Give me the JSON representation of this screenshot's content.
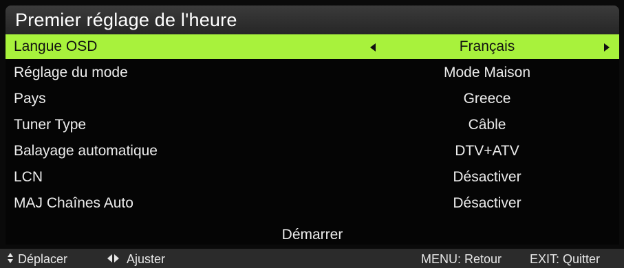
{
  "title": "Premier réglage de l'heure",
  "colors": {
    "highlight": "#a8f23c",
    "background": "#0a0a0a",
    "title_bar": "#333333",
    "footer": "#2b2b2b"
  },
  "menu": {
    "rows": [
      {
        "label": "Langue OSD",
        "value": "Français",
        "selected": true
      },
      {
        "label": "Réglage du mode",
        "value": "Mode Maison"
      },
      {
        "label": "Pays",
        "value": "Greece"
      },
      {
        "label": "Tuner Type",
        "value": "Câble"
      },
      {
        "label": "Balayage automatique",
        "value": "DTV+ATV"
      },
      {
        "label": "LCN",
        "value": "Désactiver"
      },
      {
        "label": "MAJ Chaînes Auto",
        "value": "Désactiver"
      }
    ],
    "start_label": "Démarrer"
  },
  "footer": {
    "move_icon": "up-down-arrows-icon",
    "move_label": "Déplacer",
    "adjust_icon": "left-right-arrows-icon",
    "adjust_label": "Ajuster",
    "menu_label": "MENU: Retour",
    "exit_label": "EXIT: Quitter"
  }
}
